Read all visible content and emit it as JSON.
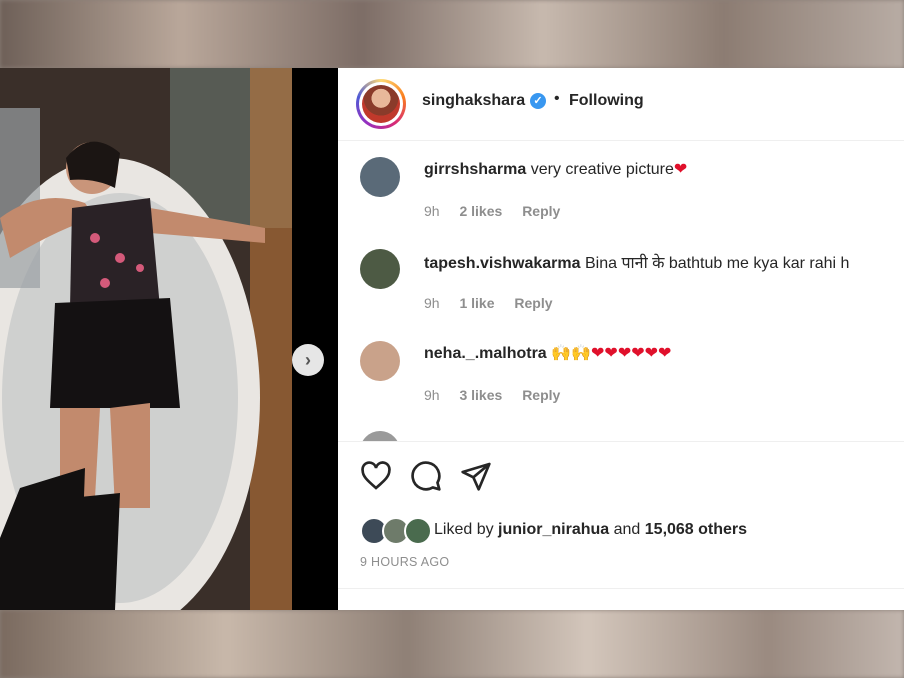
{
  "post": {
    "username": "singhakshara",
    "separator": "•",
    "follow_status": "Following",
    "verified_mark": "✓"
  },
  "comments": [
    {
      "user": "girrshsharma",
      "text": "very creative picture",
      "emoji": "❤",
      "time": "9h",
      "likes": "2 likes",
      "reply": "Reply",
      "avatar_color": "#5a6a78"
    },
    {
      "user": "tapesh.vishwakarma",
      "text": "Bina पानी के bathtub me kya kar rahi h",
      "emoji": "",
      "time": "9h",
      "likes": "1 like",
      "reply": "Reply",
      "avatar_color": "#4d5a44"
    },
    {
      "user": "neha._.malhotra",
      "text": "",
      "emoji": "🙌🙌❤❤❤❤❤❤",
      "time": "9h",
      "likes": "3 likes",
      "reply": "Reply",
      "avatar_color": "#c9a28a"
    }
  ],
  "actions": {
    "like_icon": "heart-outline-icon",
    "comment_icon": "comment-bubble-icon",
    "share_icon": "paper-plane-icon"
  },
  "likes_summary": {
    "prefix": "Liked by ",
    "user": "junior_nirahua",
    "middle": " and ",
    "count": "15,068 others"
  },
  "posted_time": "9 HOURS AGO",
  "carousel": {
    "next_icon": "›"
  },
  "colors": {
    "verified": "#3897f0",
    "heart": "#e0102b",
    "meta_gray": "#8e8e8e"
  }
}
